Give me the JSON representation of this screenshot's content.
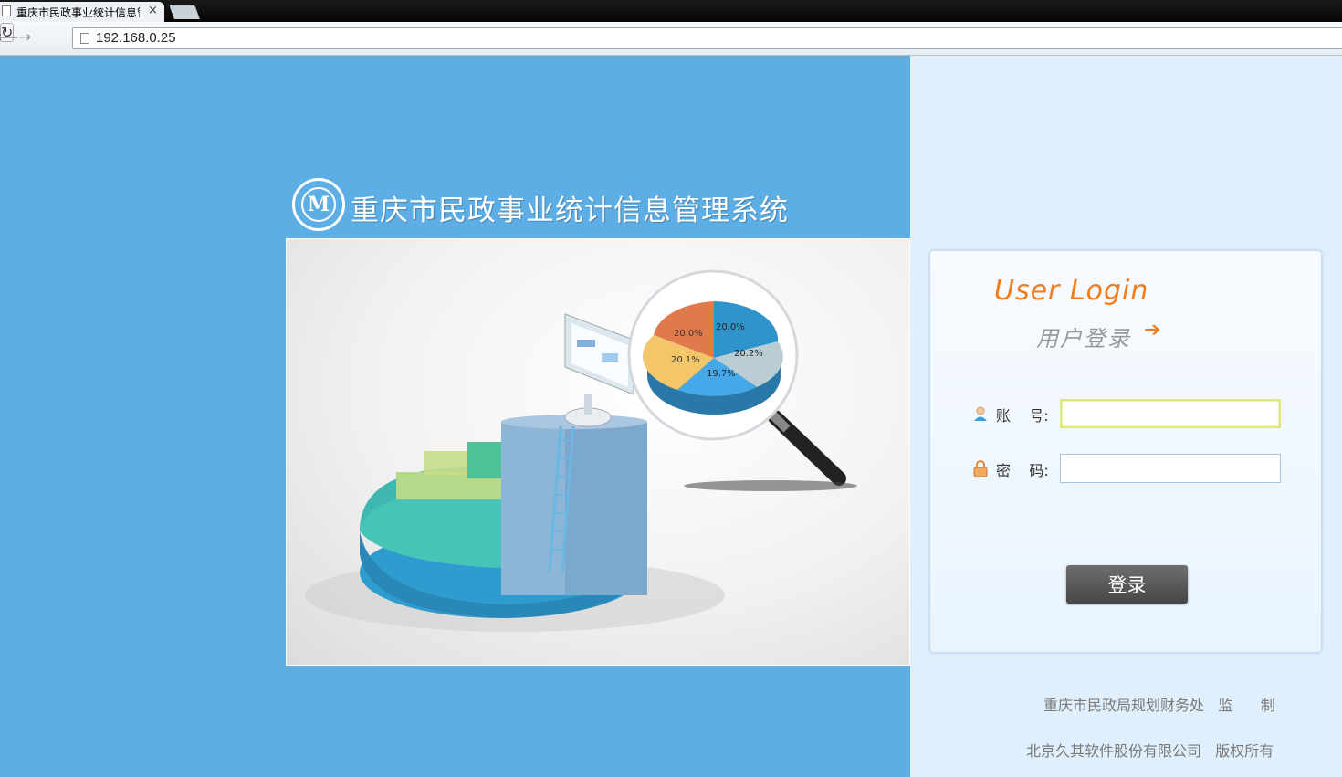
{
  "browser": {
    "tab_title": "重庆市民政事业统计信息管",
    "tab_close": "×",
    "url": "192.168.0.25",
    "back_glyph": "⟵",
    "forward_glyph": "→",
    "reload_glyph": "↻"
  },
  "header": {
    "logo_glyph": "M",
    "title": "重庆市民政事业统计信息管理系统"
  },
  "hero": {
    "pie_labels": [
      "20.0%",
      "20.0%",
      "20.2%",
      "19.7%",
      "20.1%"
    ],
    "colors": {
      "orange": "#e07a4c",
      "blue": "#2f93cc",
      "gray": "#b9cdd2",
      "lightblue": "#45a8e8",
      "yellow": "#f3c66a"
    }
  },
  "login": {
    "title_en": "User Login",
    "title_cn": "用户登录",
    "arrow": "➔",
    "username_label": "账    号:",
    "username_value": "",
    "password_label": "密    码:",
    "password_value": "",
    "submit_label": "登录",
    "icons": {
      "user": "user-icon",
      "lock": "lock-icon"
    }
  },
  "footer": {
    "line1": "重庆市民政局规划财务处   监      制",
    "line2": "北京久其软件股份有限公司   版权所有"
  },
  "colors": {
    "page_blue": "#5eaee6",
    "panel_bg": "#dfeffc",
    "accent_orange": "#f07d1e",
    "button_gray": "#555555"
  }
}
